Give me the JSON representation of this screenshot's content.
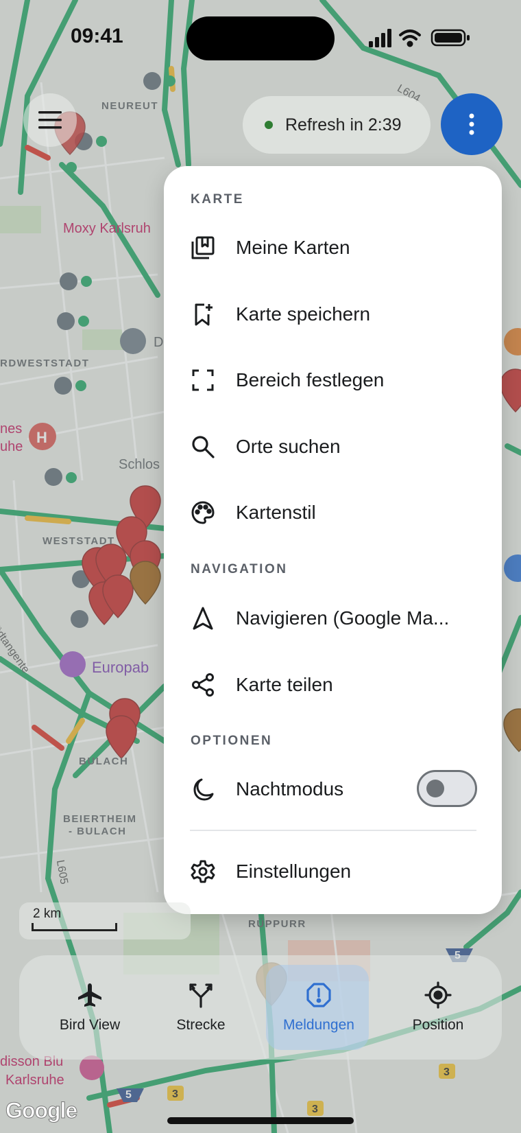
{
  "status_bar": {
    "time": "09:41"
  },
  "top": {
    "refresh_text": "Refresh in 2:39"
  },
  "map": {
    "labels": {
      "neureut": "NEUREUT",
      "moxy": "Moxy Karlsruh",
      "nordweststadt": "RDWESTSTADT",
      "nes": "nes",
      "uhe": "uhe",
      "schlos": "Schlos",
      "weststadt": "WESTSTADT",
      "suedtangente": "Südtangente",
      "europab": "Europab",
      "bulach": "BULACH",
      "beiertheim_1": "BEIERTHEIM",
      "beiertheim_2": "- BULACH",
      "rueppurr": "RÜPPURR",
      "disson": "disson Blu",
      "karlsruhe": "Karlsruhe",
      "l604": "L604",
      "l605": "L605",
      "d": "D"
    },
    "scale": "2 km",
    "attribution": "Google"
  },
  "menu": {
    "sections": {
      "karte": "KARTE",
      "navigation": "NAVIGATION",
      "optionen": "OPTIONEN"
    },
    "items": {
      "meine_karten": "Meine Karten",
      "karte_speichern": "Karte speichern",
      "bereich_festlegen": "Bereich festlegen",
      "orte_suchen": "Orte suchen",
      "kartenstil": "Kartenstil",
      "navigieren": "Navigieren (Google Ma...",
      "karte_teilen": "Karte teilen",
      "nachtmodus": "Nachtmodus",
      "einstellungen": "Einstellungen"
    },
    "nachtmodus_enabled": false
  },
  "bottom_nav": {
    "items": [
      {
        "label": "Bird View",
        "icon": "airplane-icon",
        "active": false
      },
      {
        "label": "Strecke",
        "icon": "route-fork-icon",
        "active": false
      },
      {
        "label": "Meldungen",
        "icon": "alert-icon",
        "active": true
      },
      {
        "label": "Position",
        "icon": "gps-target-icon",
        "active": false
      }
    ]
  },
  "colors": {
    "accent": "#1e63c4",
    "road_green": "#1fa463",
    "marker_red": "#c62828",
    "marker_brown": "#a0621a",
    "active_nav": "#2f6fd0"
  }
}
